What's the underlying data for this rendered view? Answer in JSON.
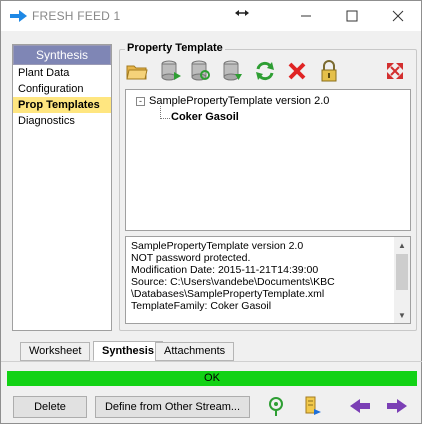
{
  "window": {
    "title": "FRESH FEED 1",
    "colors": {
      "accent": "#1e88e5",
      "status_ok": "#12d215",
      "selection": "#ffe680",
      "header": "#7f86b5"
    }
  },
  "left_panel": {
    "header": "Synthesis",
    "items": [
      {
        "label": "Plant Data",
        "selected": false
      },
      {
        "label": "Configuration",
        "selected": false
      },
      {
        "label": "Prop Templates",
        "selected": true
      },
      {
        "label": "Diagnostics",
        "selected": false
      }
    ]
  },
  "property_template": {
    "group_label": "Property Template",
    "toolbar": [
      "open-folder-icon",
      "database-import-icon",
      "database-search-icon",
      "database-export-icon",
      "refresh-icon",
      "delete-icon",
      "lock-icon",
      "expand-collapse-icon"
    ],
    "tree": {
      "expander": "-",
      "root": "SamplePropertyTemplate version 2.0",
      "child": "Coker Gasoil"
    },
    "info_lines": [
      "SamplePropertyTemplate version 2.0",
      "NOT password protected.",
      "Modification Date: 2015-11-21T14:39:00",
      "Source: C:\\Users\\vandebe\\Documents\\KBC",
      "\\Databases\\SamplePropertyTemplate.xml",
      "TemplateFamily: Coker Gasoil"
    ]
  },
  "tabs": [
    {
      "label": "Worksheet",
      "active": false
    },
    {
      "label": "Synthesis",
      "active": true
    },
    {
      "label": "Attachments",
      "active": false
    }
  ],
  "status": {
    "text": "OK"
  },
  "buttons": {
    "delete": "Delete",
    "define": "Define from Other Stream..."
  },
  "bottom_icons": [
    "recycle-icon",
    "stream-icon",
    "previous-arrow-icon",
    "next-arrow-icon"
  ]
}
